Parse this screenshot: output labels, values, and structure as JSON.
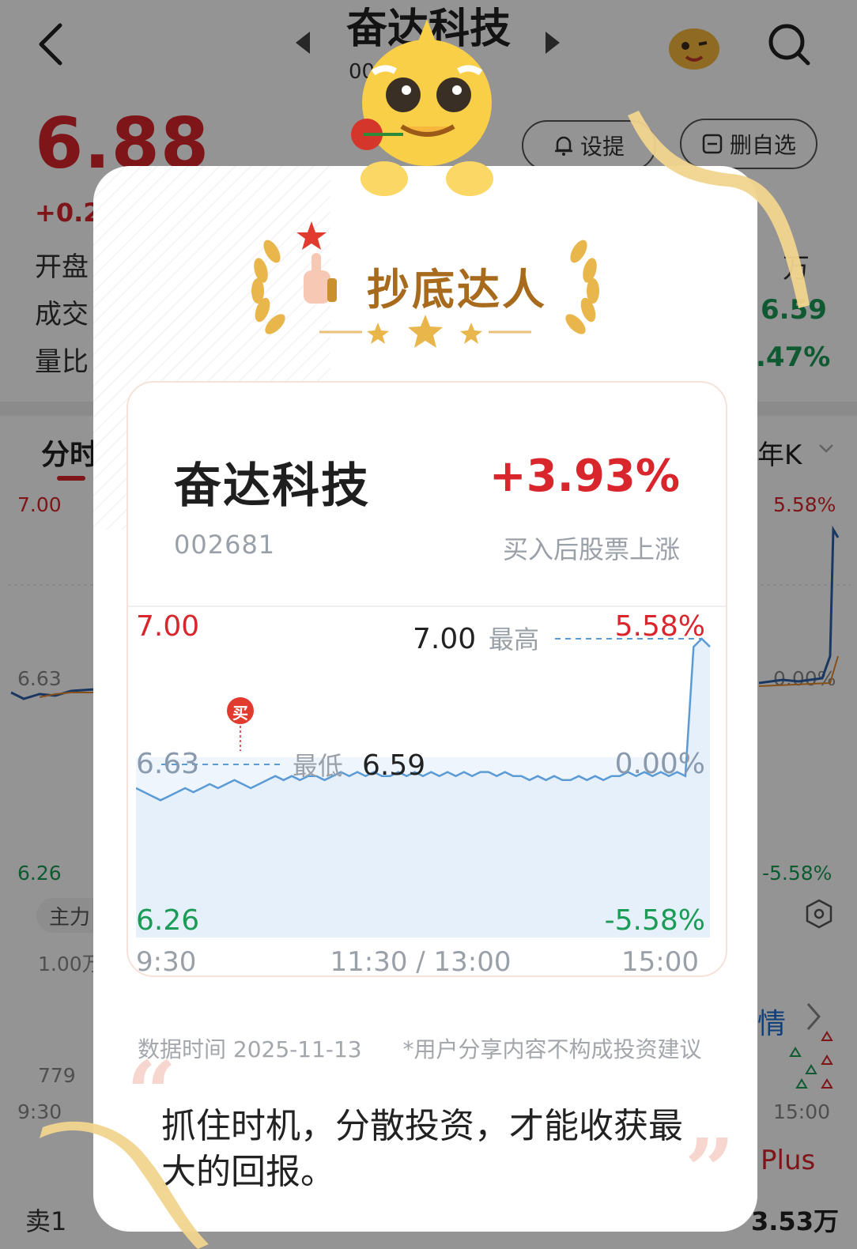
{
  "background_page": {
    "title": "奋达科技",
    "code_partial": "00",
    "price": "6.88",
    "change_partial": "+0.2",
    "remind_button": "设提",
    "delete_watch_button": "删自选",
    "row_labels": [
      "开盘",
      "成交",
      "量比"
    ],
    "row_right_values": [
      "万",
      "6.59",
      ".47%"
    ],
    "tab_minute": "分时",
    "tab_year_k": "年K",
    "axis": {
      "left_top": "7.00",
      "left_mid": "6.63",
      "left_bottom": "6.26",
      "right_top": "5.58%",
      "right_mid": "0.00%",
      "right_bottom": "-5.58%"
    },
    "indicator_chip": "主力",
    "volume_label": "1.00万",
    "volume_low": "779",
    "time_start": "9:30",
    "time_end": "15:00",
    "detail_link": "情",
    "plus_link": "Plus",
    "sell_label": "卖1",
    "sell_volume": "3.53万"
  },
  "popup": {
    "badge_title": "抄底达人",
    "stock_name": "奋达科技",
    "change_pct": "+3.93%",
    "stock_code": "002681",
    "change_note": "买入后股票上涨",
    "chart": {
      "high_label": "最高",
      "high_value": "7.00",
      "low_label": "最低",
      "low_value": "6.59",
      "buy_marker": "买",
      "axis_left_top": "7.00",
      "axis_left_mid": "6.63",
      "axis_left_bottom": "6.26",
      "axis_right_top": "5.58%",
      "axis_right_mid": "0.00%",
      "axis_right_bottom": "-5.58%",
      "time_start": "9:30",
      "time_mid": "11:30 / 13:00",
      "time_end": "15:00"
    },
    "footer_data_time": "数据时间 2025-11-13",
    "footer_disclaimer": "*用户分享内容不构成投资建议",
    "quote": "抓住时机，分散投资，才能收获最大的回报。"
  },
  "chart_data": {
    "type": "line",
    "x_range": [
      "9:30",
      "15:00"
    ],
    "ylim": [
      6.26,
      7.0
    ],
    "reference_price": 6.63,
    "high": 7.0,
    "low": 6.59,
    "values": [
      6.63,
      6.62,
      6.61,
      6.6,
      6.61,
      6.62,
      6.63,
      6.62,
      6.63,
      6.64,
      6.63,
      6.64,
      6.65,
      6.64,
      6.63,
      6.64,
      6.65,
      6.66,
      6.65,
      6.66,
      6.65,
      6.66,
      6.66,
      6.65,
      6.66,
      6.67,
      6.66,
      6.67,
      6.66,
      6.67,
      6.66,
      6.66,
      6.67,
      6.66,
      6.67,
      6.66,
      6.67,
      6.66,
      6.67,
      6.66,
      6.67,
      6.66,
      6.67,
      6.67,
      6.66,
      6.67,
      6.66,
      6.66,
      6.65,
      6.66,
      6.65,
      6.66,
      6.65,
      6.65,
      6.66,
      6.65,
      6.66,
      6.65,
      6.66,
      6.66,
      6.67,
      6.66,
      6.67,
      6.66,
      6.67,
      6.66,
      6.67,
      6.66,
      6.98,
      7.0,
      6.98
    ],
    "colors": {
      "line": "#5b9bd5",
      "fill": "#eef5fc",
      "up": "#d9262c",
      "down": "#1a9b56"
    }
  }
}
